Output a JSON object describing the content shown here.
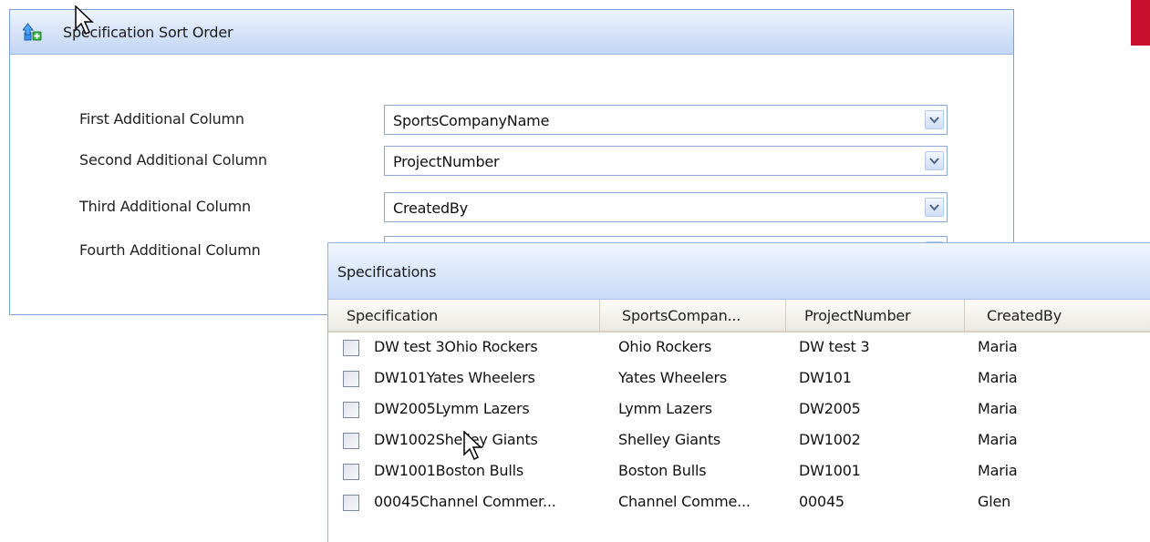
{
  "sort_panel": {
    "title": "Specification Sort Order",
    "icon": "upload-arrow-icon",
    "rows": [
      {
        "label": "First Additional Column",
        "value": "SportsCompanyName"
      },
      {
        "label": "Second Additional Column",
        "value": "ProjectNumber"
      },
      {
        "label": "Third Additional Column",
        "value": "CreatedBy"
      },
      {
        "label": "Fourth Additional Column",
        "value": ""
      }
    ]
  },
  "spec_window": {
    "title": "Specifications",
    "columns": [
      "Specification",
      "SportsCompan...",
      "ProjectNumber",
      "CreatedBy"
    ],
    "rows": [
      {
        "specification": "DW test 3Ohio Rockers",
        "company": "Ohio Rockers",
        "project": "DW test 3",
        "created_by": "Maria"
      },
      {
        "specification": "DW101Yates Wheelers",
        "company": "Yates Wheelers",
        "project": "DW101",
        "created_by": "Maria"
      },
      {
        "specification": "DW2005Lymm Lazers",
        "company": "Lymm Lazers",
        "project": "DW2005",
        "created_by": "Maria"
      },
      {
        "specification": "DW1002Shelley Giants",
        "company": "Shelley Giants",
        "project": "DW1002",
        "created_by": "Maria"
      },
      {
        "specification": "DW1001Boston Bulls",
        "company": "Boston Bulls",
        "project": "DW1001",
        "created_by": "Maria"
      },
      {
        "specification": "00045Channel Commer...",
        "company": "Channel Comme...",
        "project": "00045",
        "created_by": "Glen"
      }
    ]
  },
  "colors": {
    "panel_border": "#7e9fd6",
    "header_gradient": "#d4e2f8",
    "accent_red": "#c8102e"
  }
}
